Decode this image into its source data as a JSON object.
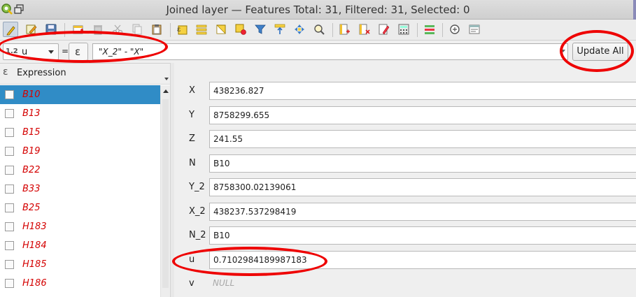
{
  "window": {
    "title": "Joined layer — Features Total: 31, Filtered: 31, Selected: 0"
  },
  "toolbar": {
    "icons": [
      "toggle-editing-icon",
      "multi-edit-icon",
      "save-edits-icon",
      "add-feature-icon",
      "delete-feature-icon",
      "cut-icon",
      "copy-icon",
      "paste-icon",
      "expression-select-icon",
      "select-all-icon",
      "invert-selection-icon",
      "deselect-all-icon",
      "filter-select-icon",
      "move-selection-top-icon",
      "pan-to-selection-icon",
      "zoom-to-selection-icon",
      "new-field-icon",
      "delete-field-icon",
      "edit-field-icon",
      "field-calculator-icon",
      "conditional-formatting-icon",
      "dock-icon",
      "actions-icon"
    ]
  },
  "exprbar": {
    "field_type": "1.2",
    "field": "u",
    "equals": "=",
    "epsilon": "ε",
    "expression": "\"X_2\"  -  \"X\"",
    "update_all": "Update All"
  },
  "list": {
    "header_icon": "ε",
    "header": "Expression",
    "items": [
      "B10",
      "B13",
      "B15",
      "B19",
      "B22",
      "B33",
      "B25",
      "H183",
      "H184",
      "H185",
      "H186"
    ],
    "selected_index": 0
  },
  "form": {
    "fields": [
      {
        "label": "X",
        "value": "438236.827"
      },
      {
        "label": "Y",
        "value": "8758299.655"
      },
      {
        "label": "Z",
        "value": "241.55"
      },
      {
        "label": "N",
        "value": "B10"
      },
      {
        "label": "Y_2",
        "value": "8758300.02139061"
      },
      {
        "label": "X_2",
        "value": "438237.537298419"
      },
      {
        "label": "N_2",
        "value": "B10"
      },
      {
        "label": "u",
        "value": "0.7102984189987183"
      },
      {
        "label": "v",
        "value": "NULL"
      }
    ]
  },
  "colors": {
    "selection": "#308cc6",
    "item_text": "#d40000",
    "annotation": "#ee0000"
  }
}
